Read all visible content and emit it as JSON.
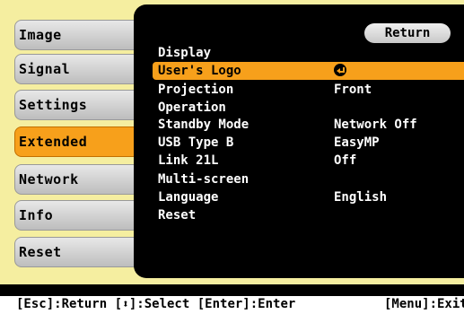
{
  "sidebar": {
    "items": [
      {
        "label": "Image"
      },
      {
        "label": "Signal"
      },
      {
        "label": "Settings"
      },
      {
        "label": "Extended"
      },
      {
        "label": "Network"
      },
      {
        "label": "Info"
      },
      {
        "label": "Reset"
      }
    ],
    "active": "Extended"
  },
  "panel": {
    "return_label": "Return",
    "items": [
      {
        "label": "Display",
        "value": ""
      },
      {
        "label": "User's Logo",
        "value": ""
      },
      {
        "label": "Projection",
        "value": "Front"
      },
      {
        "label": "Operation",
        "value": ""
      },
      {
        "label": "Standby Mode",
        "value": "Network Off"
      },
      {
        "label": "USB Type B",
        "value": "EasyMP"
      },
      {
        "label": "Link 21L",
        "value": "Off"
      },
      {
        "label": "Multi-screen",
        "value": ""
      },
      {
        "label": "Language",
        "value": "English"
      },
      {
        "label": "Reset",
        "value": ""
      }
    ],
    "selected": "User's Logo",
    "selected_icon": "enter-icon"
  },
  "footer": {
    "esc": "[Esc]:Return",
    "select_prefix": "[",
    "select_icon": "⬍",
    "select_suffix": "]:Select",
    "enter": "[Enter]:Enter",
    "menu": "[Menu]:Exit"
  },
  "colors": {
    "accent": "#f7a01b",
    "background": "#f5eea0",
    "panel": "#000000"
  }
}
